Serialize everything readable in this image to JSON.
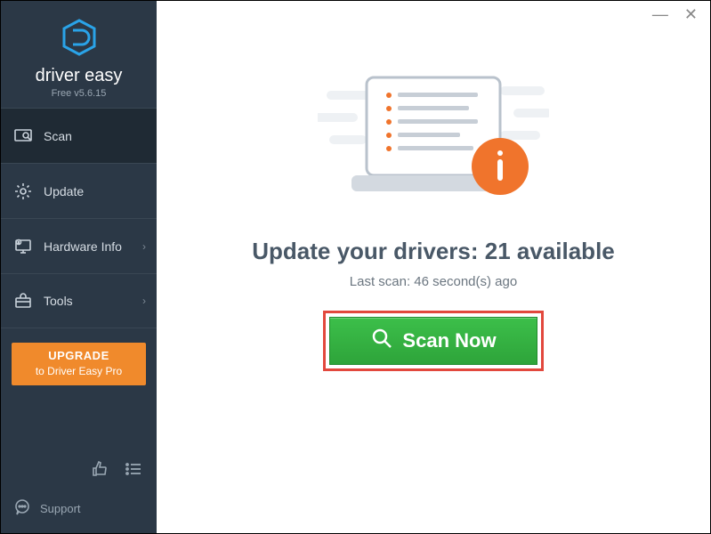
{
  "brand": {
    "name": "driver easy",
    "version": "Free v5.6.15"
  },
  "nav": {
    "scan": "Scan",
    "update": "Update",
    "hardware": "Hardware Info",
    "tools": "Tools"
  },
  "upgrade": {
    "line1": "UPGRADE",
    "line2": "to Driver Easy Pro"
  },
  "support": "Support",
  "headline_prefix": "Update your drivers: ",
  "available_count": "21",
  "headline_suffix": " available",
  "last_scan": "Last scan: 46 second(s) ago",
  "scan_button": "Scan Now"
}
